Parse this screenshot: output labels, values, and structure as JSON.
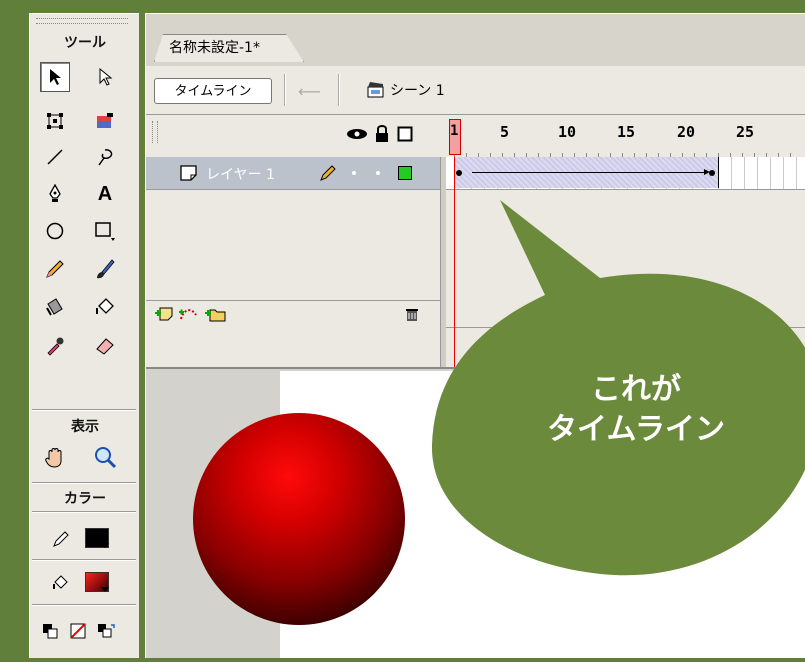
{
  "toolbox": {
    "tools_header": "ツール",
    "view_header": "表示",
    "colors_header": "カラー",
    "text_tool_glyph": "A"
  },
  "document": {
    "tab_title": "名称未設定-1*",
    "timeline_button": "タイムライン",
    "scene_label": "シーン 1"
  },
  "timeline": {
    "layer_name": "レイヤー 1",
    "current_frame": "1",
    "frame_numbers": [
      "5",
      "10",
      "15",
      "20",
      "25"
    ]
  },
  "callout": {
    "line1": "これが",
    "line2": "タイムライン",
    "fill_color": "#6b8a3c"
  },
  "colors": {
    "frame_green": "#5f7f3a",
    "stroke_swatch": "#000000",
    "fill_swatch": "#cc0000",
    "ball_highlight": "#ff0a0a",
    "ball_shadow": "#120000"
  }
}
